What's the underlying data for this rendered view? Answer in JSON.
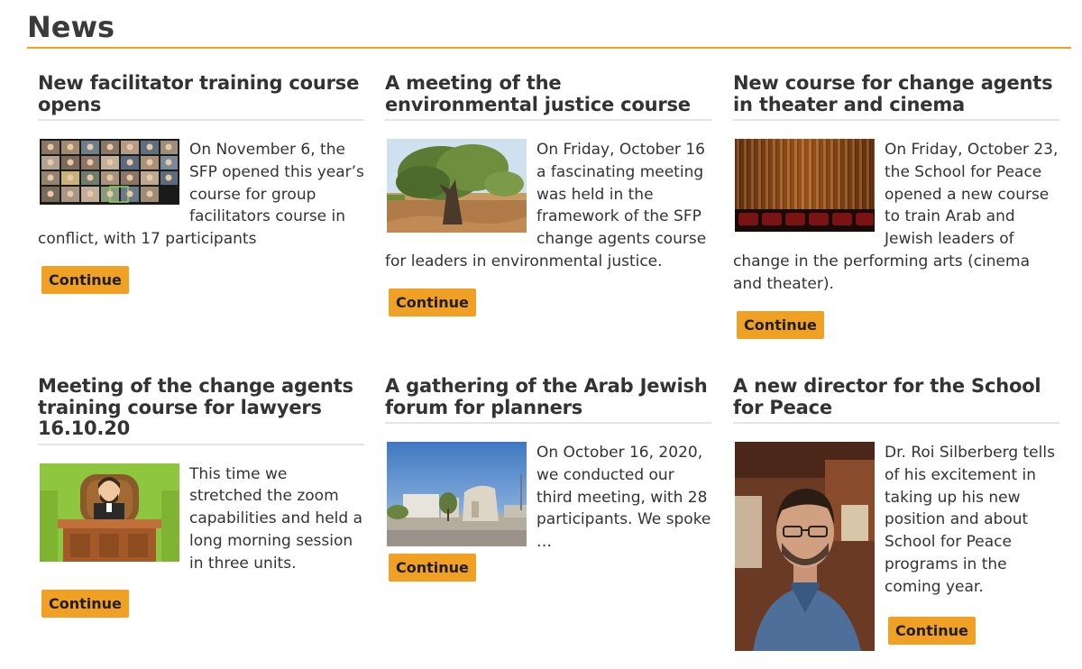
{
  "page": {
    "title": "News"
  },
  "colors": {
    "accent": "#f0a023",
    "divider": "#e4e4e4",
    "text": "#333333"
  },
  "articles": [
    {
      "title": "New facilitator training course opens",
      "excerpt": "On November 6, the SFP opened this year’s course for group facilitators course in conflict, with 17 participants",
      "image": "zoom-meeting-grid",
      "button": "Continue"
    },
    {
      "title": "A meeting of the environmental justice course",
      "excerpt": "On Friday, October 16 a fascinating meeting was held in the framework of the SFP change agents course for leaders in environmental justice.",
      "image": "olive-tree",
      "button": "Continue"
    },
    {
      "title": "New course for change agents in theater and cinema",
      "excerpt": "On Friday, October 23, the School for Peace opened a new course to train Arab and Jewish leaders of change in the performing arts (cinema and theater).",
      "image": "theater-curtain",
      "button": "Continue"
    },
    {
      "title": "Meeting of the change agents training course for lawyers 16.10.20",
      "excerpt": "This time we stretched the zoom capabilities and held a long morning session in three units.",
      "image": "judge-illustration",
      "button": "Continue"
    },
    {
      "title": "A gathering of the Arab Jewish forum for planners",
      "excerpt": "On October 16, 2020, we conducted our third meeting, with 28 participants. We spoke …",
      "image": "stone-building",
      "button": "Continue"
    },
    {
      "title": "A new director for the School for Peace",
      "excerpt": "Dr. Roi Silberberg tells of his excitement in taking up his new position and about School for Peace programs in the coming year.",
      "image": "director-portrait",
      "button": "Continue"
    }
  ]
}
